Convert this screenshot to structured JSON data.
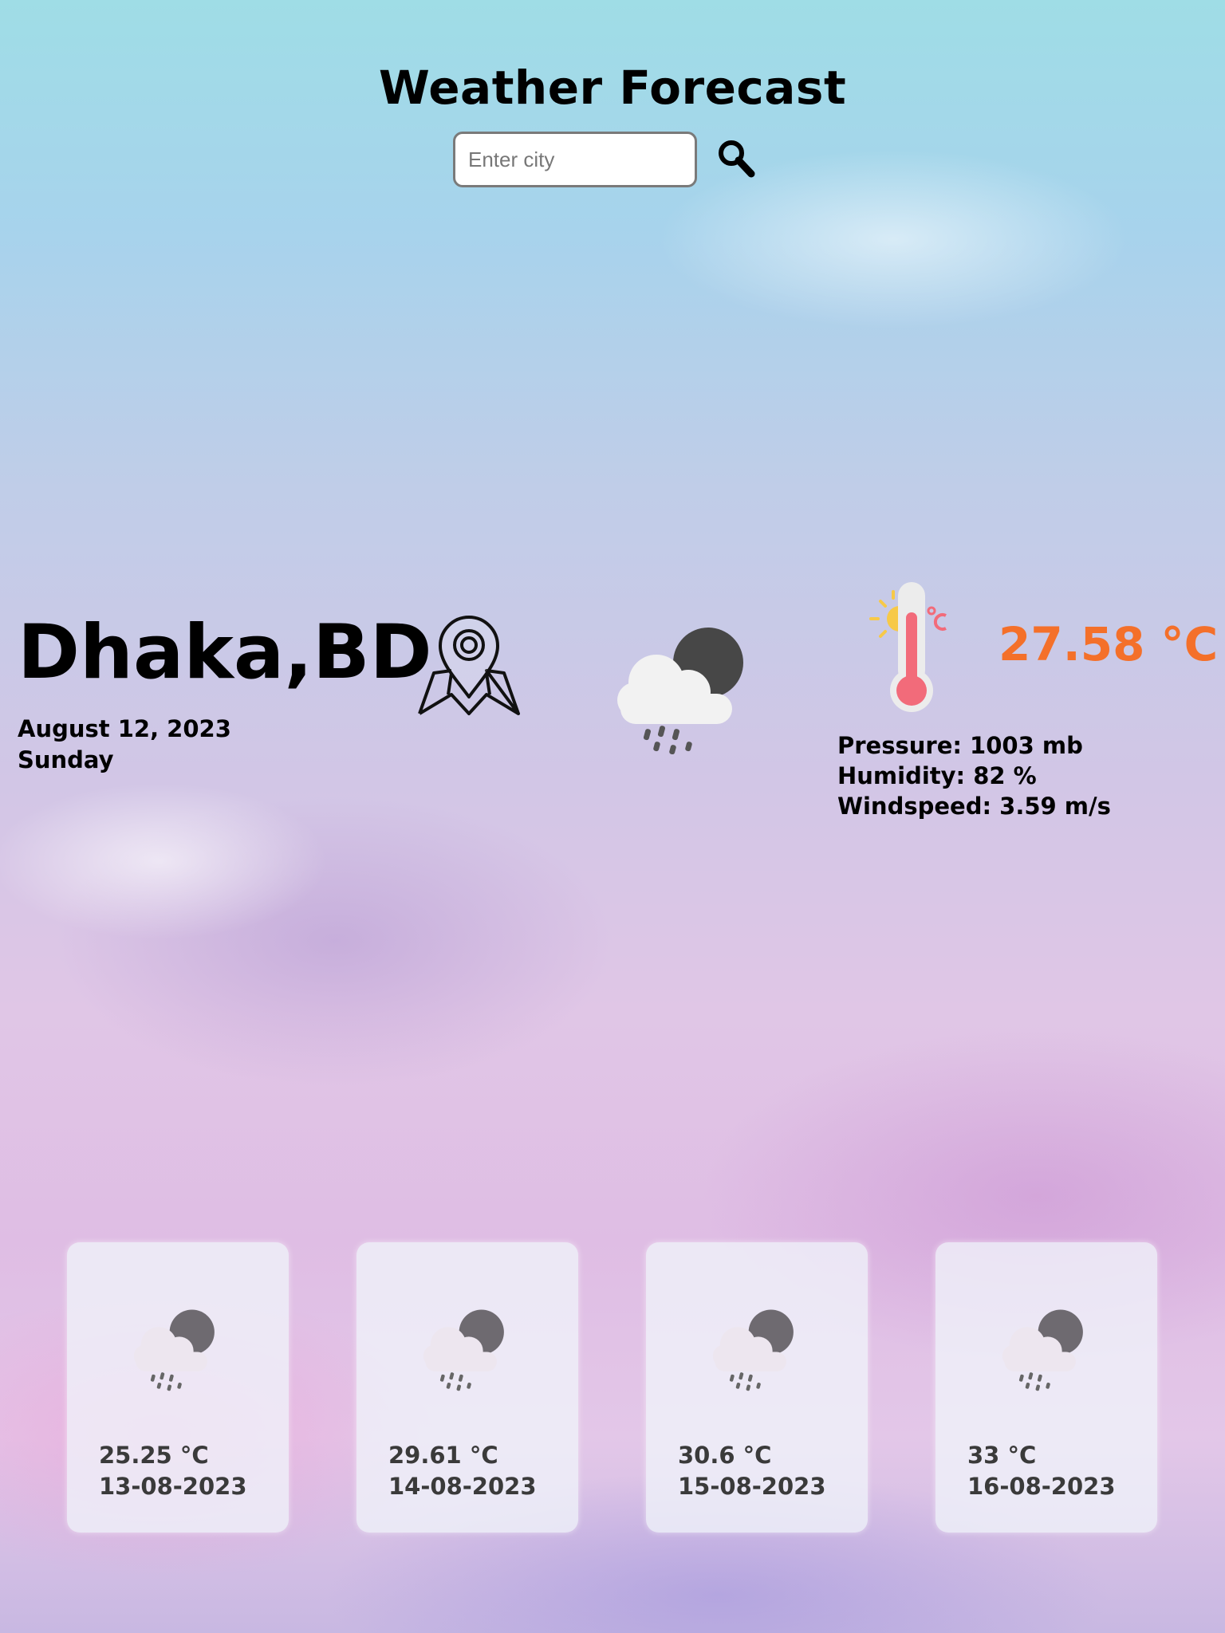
{
  "header": {
    "title": "Weather Forecast"
  },
  "search": {
    "placeholder": "Enter city",
    "value": ""
  },
  "current": {
    "city": "Dhaka,BD",
    "date": "August 12, 2023",
    "day": "Sunday",
    "temperature": "27.58 °C",
    "pressure": "Pressure: 1003 mb",
    "humidity": "Humidity: 82 %",
    "windspeed": "Windspeed: 3.59 m/s",
    "icon": "night-rain-cloud-icon"
  },
  "forecast": [
    {
      "temp": "25.25 °C",
      "date": "13-08-2023",
      "icon": "night-rain-cloud-icon"
    },
    {
      "temp": "29.61 °C",
      "date": "14-08-2023",
      "icon": "night-rain-cloud-icon"
    },
    {
      "temp": "30.6 °C",
      "date": "15-08-2023",
      "icon": "night-rain-cloud-icon"
    },
    {
      "temp": "33 °C",
      "date": "16-08-2023",
      "icon": "night-rain-cloud-icon"
    }
  ],
  "colors": {
    "temperature": "#f4702a",
    "card_background": "#f0f4fa"
  }
}
